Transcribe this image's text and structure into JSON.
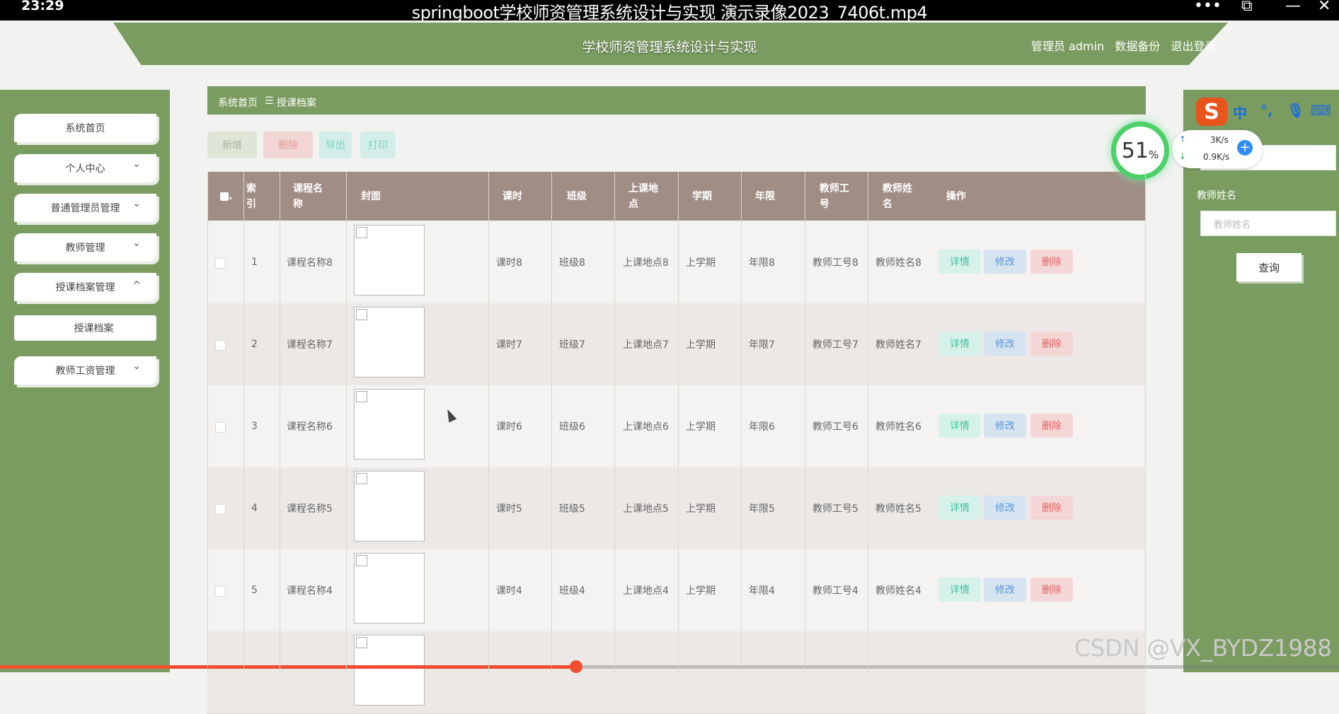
{
  "player": {
    "time": "23:29",
    "title": "springboot学校师资管理系统设计与实现 演示录像2023_7406t.mp4",
    "progress_percent": 43
  },
  "header": {
    "title": "学校师资管理系统设计与实现",
    "user": "管理员 admin",
    "backup": "数据备份",
    "logout": "退出登录"
  },
  "sidebar": {
    "items": [
      {
        "label": "系统首页"
      },
      {
        "label": "个人中心"
      },
      {
        "label": "普通管理员管理"
      },
      {
        "label": "教师管理"
      },
      {
        "label": "授课档案管理"
      },
      {
        "label": "授课档案"
      },
      {
        "label": "教师工资管理"
      }
    ]
  },
  "breadcrumb": {
    "home": "系统首页",
    "sep": "☰",
    "current": "授课档案"
  },
  "actions": {
    "add": "新增",
    "delete": "删除",
    "export": "导出",
    "print": "打印"
  },
  "table": {
    "headers": [
      "索引",
      "课程名称",
      "封面",
      "课时",
      "班级",
      "上课地点",
      "学期",
      "年限",
      "教师工号",
      "教师姓名",
      "操作"
    ],
    "header_lines": {
      "index": [
        "索",
        "引"
      ],
      "course": [
        "课程名",
        "称"
      ],
      "place": [
        "上课地",
        "点"
      ],
      "teacher_no": [
        "教师工",
        "号"
      ],
      "teacher_name": [
        "教师姓",
        "名"
      ]
    },
    "rows": [
      {
        "idx": "1",
        "course": "课程名称8",
        "hours": "课时8",
        "class": "班级8",
        "place": "上课地点8",
        "term": "上学期",
        "years": "年限8",
        "teacher_no": "教师工号8",
        "teacher_name": "教师姓名8"
      },
      {
        "idx": "2",
        "course": "课程名称7",
        "hours": "课时7",
        "class": "班级7",
        "place": "上课地点7",
        "term": "上学期",
        "years": "年限7",
        "teacher_no": "教师工号7",
        "teacher_name": "教师姓名7"
      },
      {
        "idx": "3",
        "course": "课程名称6",
        "hours": "课时6",
        "class": "班级6",
        "place": "上课地点6",
        "term": "上学期",
        "years": "年限6",
        "teacher_no": "教师工号6",
        "teacher_name": "教师姓名6"
      },
      {
        "idx": "4",
        "course": "课程名称5",
        "hours": "课时5",
        "class": "班级5",
        "place": "上课地点5",
        "term": "上学期",
        "years": "年限5",
        "teacher_no": "教师工号5",
        "teacher_name": "教师姓名5"
      },
      {
        "idx": "5",
        "course": "课程名称4",
        "hours": "课时4",
        "class": "班级4",
        "place": "上课地点4",
        "term": "上学期",
        "years": "年限4",
        "teacher_no": "教师工号4",
        "teacher_name": "教师姓名4"
      }
    ],
    "row_actions": {
      "detail": "详情",
      "edit": "修改",
      "delete": "删除"
    }
  },
  "search": {
    "teacher_name_label": "教师姓名",
    "teacher_name_placeholder": "教师姓名",
    "query_button": "查询"
  },
  "overlays": {
    "net_percent": "51",
    "up": "3K/s",
    "down": "0.9K/s",
    "ime_mode": "中",
    "watermark": "CSDN @VX_BYDZ1988"
  },
  "colors": {
    "theme_green": "#7a9c60",
    "table_header": "#a08e85",
    "accent_red": "#f04e30"
  }
}
